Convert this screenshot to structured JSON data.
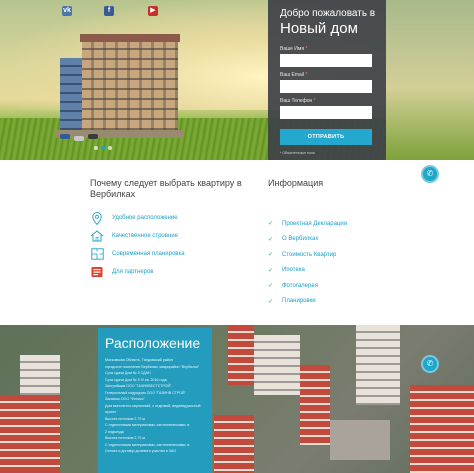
{
  "hero": {
    "social": [
      {
        "name": "vk-icon",
        "glyph": "vk",
        "color": "#4a76a8"
      },
      {
        "name": "facebook-icon",
        "glyph": "f",
        "color": "#3b5998"
      },
      {
        "name": "youtube-icon",
        "glyph": "▶",
        "color": "#c4302b"
      }
    ],
    "slider_dots": 3,
    "active_dot": 1
  },
  "form": {
    "title_line1": "Добро пожаловать в",
    "title_line2": "Новый дом",
    "name_label": "Ваше Имя",
    "email_label": "Ваш Email",
    "phone_label": "Ваш Телефон",
    "required_mark": "*",
    "submit_label": "ОТПРАВИТЬ",
    "note": "* Обязательные поля"
  },
  "why": {
    "title": "Почему следует выбрать квартиру в Вербилках",
    "features": [
      {
        "label": "Удобное расположение",
        "icon": "location-pin-icon"
      },
      {
        "label": "Качественное стровние",
        "icon": "house-icon"
      },
      {
        "label": "Современная планировка",
        "icon": "floorplan-icon"
      },
      {
        "label": "Для партнеров",
        "icon": "partners-icon"
      }
    ]
  },
  "info": {
    "title": "Информация",
    "items": [
      "Проектная Декларация",
      "О Вербилках",
      "Стоимость Квартир",
      "Ипотека",
      "Фотогалерея",
      "Планировки"
    ]
  },
  "location": {
    "title": "Расположение",
    "lines": [
      "Московская Область, Талдомский район",
      "городское поселение Вербилки, микрорайон \"Вербилки\"",
      "Срок сдачи Дом № 3 СДАН",
      "Срок сдачи Дом № 5 IV кв. 2016 года",
      "Застройщик ООО \"ГАЗИНВЕСТСТРОЙ\"",
      "Генеральный подрядчик ООО \"ГАЗИНВ СТРОЙ\"",
      "Заказчик ООО \"Феникс\"",
      "Дом монолитно-кирпичный, с отделкой, индивидуальный",
      "проект",
      "Высота потолков 2,70 м",
      "С отделочными материалами, сантехническими, в",
      "2 подъезда",
      "Высота потолков 2,70 м",
      "С отделочными материалами, сантехническими, в",
      "Оплата и договор долевого участия в ЗАО"
    ]
  },
  "colors": {
    "accent": "#1ca7cf",
    "form_bg": "#3e4248",
    "text_dark": "#444444"
  }
}
